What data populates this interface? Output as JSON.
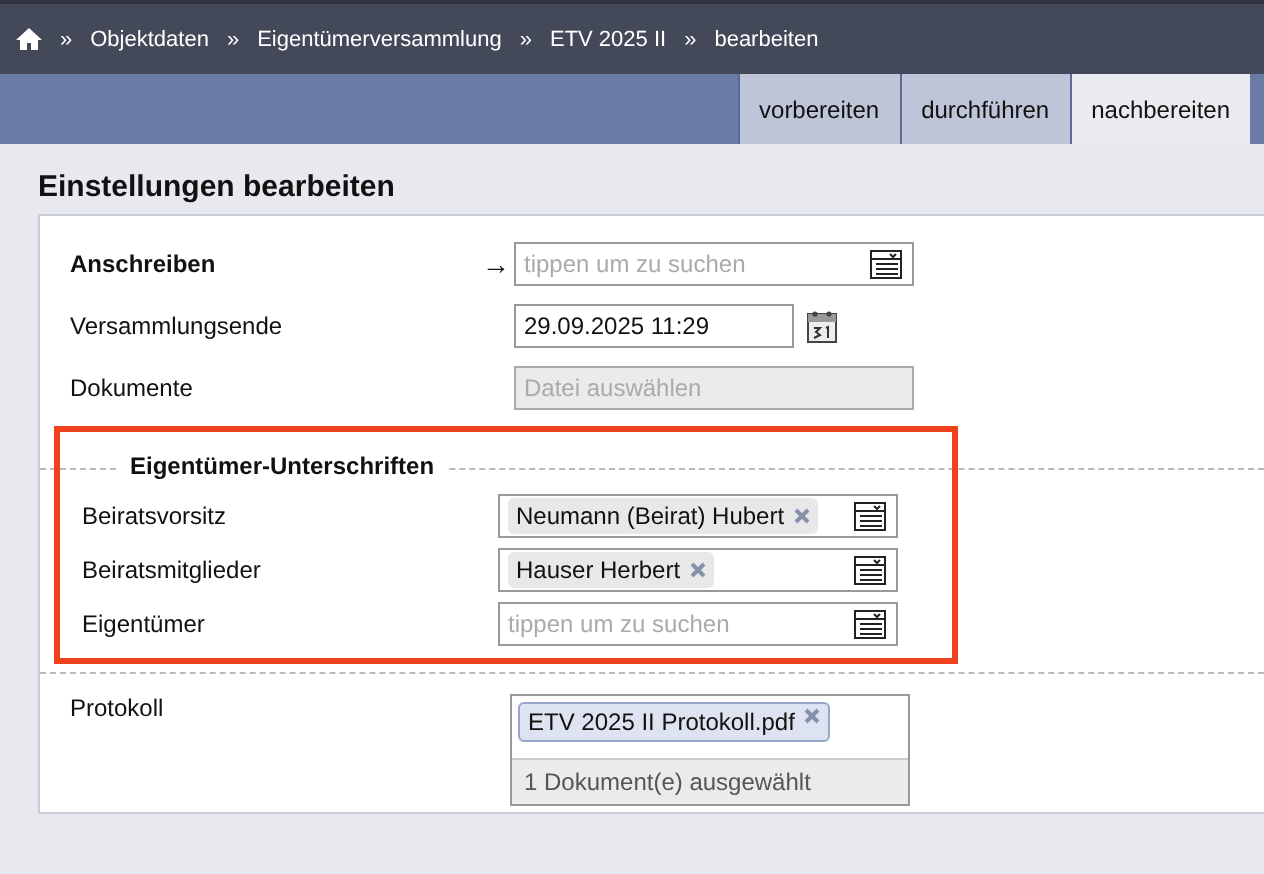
{
  "breadcrumb": {
    "separator": "»",
    "items": [
      "Objektdaten",
      "Eigentümerversammlung",
      "ETV 2025 II",
      "bearbeiten"
    ]
  },
  "tabs": [
    {
      "label": "vorbereiten",
      "selected": false
    },
    {
      "label": "durchführen",
      "selected": false
    },
    {
      "label": "nachbereiten",
      "selected": true
    }
  ],
  "title": "Einstellungen bearbeiten",
  "rows": [
    {
      "label": "Anschreiben",
      "emphasized": true,
      "marker": "→",
      "kind": "search",
      "placeholder": "tippen um zu suchen"
    },
    {
      "label": "Versammlungsende",
      "emphasized": false,
      "kind": "date",
      "value": "29.09.2025 11:29"
    },
    {
      "label": "Dokumente",
      "emphasized": false,
      "kind": "file",
      "placeholder": "Datei auswählen"
    }
  ],
  "section": {
    "title": "Eigentümer-Unterschriften",
    "highlighted": true,
    "rows": [
      {
        "label": "Beiratsvorsitz",
        "kind": "tags",
        "tags": [
          "Neumann (Beirat) Hubert"
        ]
      },
      {
        "label": "Beiratsmitglieder",
        "kind": "tags",
        "tags": [
          "Hauser Herbert"
        ]
      },
      {
        "label": "Eigentümer",
        "kind": "search",
        "placeholder": "tippen um zu suchen"
      }
    ]
  },
  "protocol": {
    "label": "Protokoll",
    "files": [
      "ETV 2025 II Protokoll.pdf"
    ],
    "status": "1 Dokument(e) ausgewählt"
  }
}
